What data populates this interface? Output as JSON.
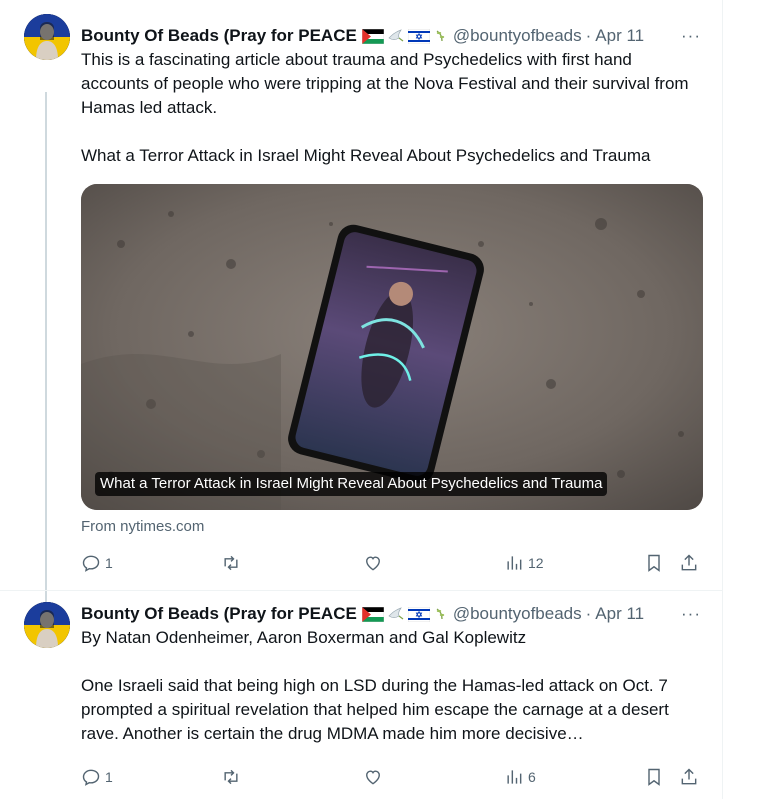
{
  "tweets": [
    {
      "author": {
        "name": "Bounty Of Beads (Pray for PEACE",
        "handle": "@bountyofbeads",
        "date": "Apr 11"
      },
      "text": {
        "p1": "This is a fascinating article about trauma and Psychedelics with first hand accounts of people who were tripping at the Nova Festival and their survival from Hamas led attack.",
        "p2": "What a Terror Attack in Israel Might Reveal About Psychedelics and Trauma"
      },
      "card": {
        "caption": "What a Terror Attack in Israel Might Reveal About Psychedelics and Trauma",
        "source": "From nytimes.com"
      },
      "stats": {
        "replies": "1",
        "views": "12"
      }
    },
    {
      "author": {
        "name": "Bounty Of Beads (Pray for PEACE",
        "handle": "@bountyofbeads",
        "date": "Apr 11"
      },
      "text": {
        "p1": "By Natan Odenheimer, Aaron Boxerman and Gal Koplewitz",
        "p2": "One Israeli said that being high on LSD during the Hamas-led attack on Oct. 7 prompted a spiritual revelation that helped him escape the carnage at a desert rave. Another is certain the drug MDMA made him more decisive…"
      },
      "stats": {
        "replies": "1",
        "views": "6"
      }
    }
  ],
  "ui": {
    "dot": "·",
    "more": "···"
  },
  "colors": {
    "text": "#0f1419",
    "secondary": "#536471",
    "border": "#eff3f4"
  },
  "icons": [
    "reply-icon",
    "retweet-icon",
    "like-icon",
    "views-icon",
    "bookmark-icon",
    "share-icon",
    "more-icon"
  ]
}
